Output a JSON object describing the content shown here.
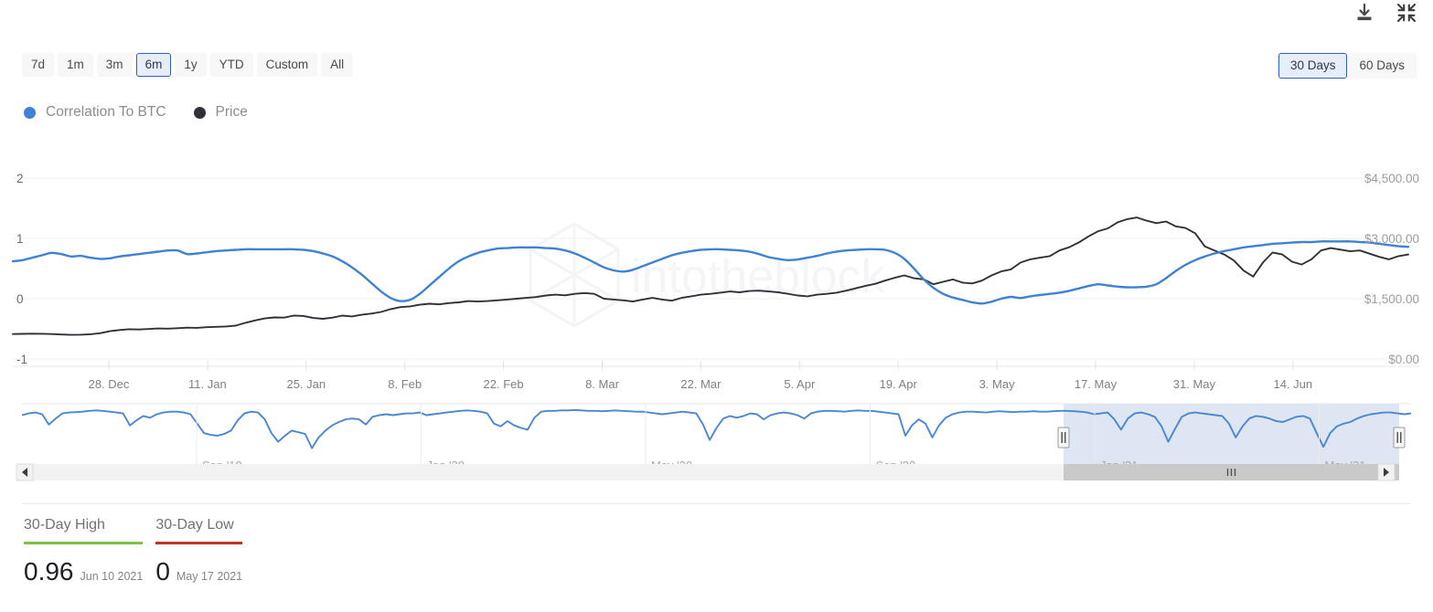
{
  "toolbar": {
    "download_icon": "download-icon",
    "collapse_icon": "collapse-icon"
  },
  "range_selector": {
    "buttons": [
      {
        "label": "7d",
        "active": false
      },
      {
        "label": "1m",
        "active": false
      },
      {
        "label": "3m",
        "active": false
      },
      {
        "label": "6m",
        "active": true
      },
      {
        "label": "1y",
        "active": false
      },
      {
        "label": "YTD",
        "active": false
      },
      {
        "label": "Custom",
        "active": false
      },
      {
        "label": "All",
        "active": false
      }
    ]
  },
  "window_selector": {
    "buttons": [
      {
        "label": "30 Days",
        "active": true
      },
      {
        "label": "60 Days",
        "active": false
      }
    ]
  },
  "legend": {
    "items": [
      {
        "label": "Correlation To BTC",
        "color": "#3e82d4",
        "icon": "circle-icon"
      },
      {
        "label": "Price",
        "color": "#2f3236",
        "icon": "circle-icon"
      }
    ]
  },
  "watermark": {
    "text": "intotheblock",
    "logo_icon": "intotheblock-logo-icon"
  },
  "navigator": {
    "tick_labels": [
      "Sep '19",
      "Jan '20",
      "May '20",
      "Sep '20",
      "Jan '21",
      "May '21"
    ],
    "selection_color": "#c3d0ea",
    "left_arrow_icon": "scroll-left-arrow-icon",
    "right_arrow_icon": "scroll-right-arrow-icon",
    "grip_icon": "scrollbar-grip-icon",
    "left_handle_icon": "range-handle-left-icon",
    "right_handle_icon": "range-handle-right-icon"
  },
  "stats": [
    {
      "title": "30-Day High",
      "value": "0.96",
      "date": "Jun 10 2021",
      "rule_color": "#7ec144"
    },
    {
      "title": "30-Day Low",
      "value": "0",
      "date": "May 17 2021",
      "rule_color": "#b8362b"
    }
  ],
  "chart_data": {
    "type": "line",
    "title": "",
    "xlabel": "",
    "ylabel": "",
    "grid": true,
    "legend_position": "top-left",
    "x_tick_labels": [
      "28. Dec",
      "11. Jan",
      "25. Jan",
      "8. Feb",
      "22. Feb",
      "8. Mar",
      "22. Mar",
      "5. Apr",
      "19. Apr",
      "3. May",
      "17. May",
      "31. May",
      "14. Jun"
    ],
    "left_axis": {
      "name": "Correlation To BTC",
      "tick_labels": [
        "2",
        "1",
        "0",
        "-1"
      ],
      "ticks": [
        2,
        1,
        0,
        -1
      ],
      "ylim": [
        -1,
        2
      ]
    },
    "right_axis": {
      "name": "Price",
      "tick_labels": [
        "$4,500.00",
        "$3,000.00",
        "$1,500.00",
        "$0.00"
      ],
      "ticks": [
        4500,
        3000,
        1500,
        0
      ],
      "ylim": [
        0,
        4500
      ]
    },
    "series": [
      {
        "name": "Correlation To BTC",
        "color": "#3e82d4",
        "axis": "left",
        "values": [
          0.62,
          0.64,
          0.68,
          0.72,
          0.76,
          0.74,
          0.7,
          0.71,
          0.68,
          0.66,
          0.67,
          0.7,
          0.72,
          0.74,
          0.76,
          0.78,
          0.8,
          0.8,
          0.74,
          0.75,
          0.77,
          0.79,
          0.8,
          0.81,
          0.82,
          0.82,
          0.82,
          0.82,
          0.82,
          0.82,
          0.81,
          0.79,
          0.75,
          0.7,
          0.62,
          0.52,
          0.4,
          0.26,
          0.12,
          0.01,
          -0.04,
          -0.02,
          0.08,
          0.22,
          0.36,
          0.5,
          0.62,
          0.7,
          0.76,
          0.8,
          0.83,
          0.84,
          0.85,
          0.85,
          0.85,
          0.84,
          0.83,
          0.8,
          0.75,
          0.68,
          0.6,
          0.52,
          0.47,
          0.45,
          0.48,
          0.54,
          0.6,
          0.66,
          0.72,
          0.76,
          0.79,
          0.81,
          0.82,
          0.82,
          0.81,
          0.8,
          0.78,
          0.74,
          0.69,
          0.66,
          0.64,
          0.65,
          0.68,
          0.71,
          0.75,
          0.78,
          0.8,
          0.81,
          0.82,
          0.82,
          0.81,
          0.76,
          0.66,
          0.5,
          0.32,
          0.18,
          0.08,
          0.02,
          -0.02,
          -0.06,
          -0.08,
          -0.05,
          0.0,
          0.03,
          0.01,
          0.04,
          0.06,
          0.08,
          0.1,
          0.13,
          0.17,
          0.21,
          0.24,
          0.22,
          0.2,
          0.19,
          0.19,
          0.2,
          0.24,
          0.34,
          0.46,
          0.56,
          0.64,
          0.7,
          0.75,
          0.79,
          0.82,
          0.85,
          0.87,
          0.89,
          0.91,
          0.92,
          0.93,
          0.94,
          0.94,
          0.95,
          0.95,
          0.95,
          0.95,
          0.94,
          0.93,
          0.91,
          0.89,
          0.87,
          0.86
        ]
      },
      {
        "name": "Price",
        "color": "#2f3236",
        "axis": "right",
        "values": [
          620,
          625,
          630,
          628,
          620,
          610,
          600,
          605,
          615,
          640,
          690,
          720,
          740,
          735,
          745,
          760,
          755,
          765,
          780,
          775,
          790,
          800,
          810,
          830,
          900,
          960,
          1010,
          1035,
          1030,
          1080,
          1070,
          1020,
          1000,
          1030,
          1080,
          1060,
          1100,
          1130,
          1170,
          1240,
          1290,
          1310,
          1350,
          1375,
          1360,
          1390,
          1410,
          1440,
          1430,
          1440,
          1460,
          1480,
          1500,
          1520,
          1540,
          1580,
          1600,
          1585,
          1620,
          1640,
          1620,
          1500,
          1480,
          1460,
          1430,
          1480,
          1520,
          1480,
          1450,
          1520,
          1560,
          1600,
          1620,
          1650,
          1680,
          1660,
          1690,
          1700,
          1680,
          1660,
          1620,
          1580,
          1560,
          1600,
          1620,
          1650,
          1700,
          1760,
          1820,
          1870,
          1950,
          2020,
          2080,
          2010,
          1980,
          1860,
          1920,
          1980,
          1900,
          1880,
          1950,
          2080,
          2180,
          2230,
          2400,
          2480,
          2520,
          2560,
          2700,
          2780,
          2900,
          3050,
          3180,
          3250,
          3400,
          3480,
          3520,
          3440,
          3380,
          3420,
          3300,
          3260,
          3130,
          2800,
          2700,
          2600,
          2450,
          2200,
          2050,
          2400,
          2650,
          2600,
          2420,
          2350,
          2480,
          2700,
          2760,
          2720,
          2680,
          2700,
          2620,
          2540,
          2480,
          2560,
          2600
        ]
      }
    ],
    "navigator_series": {
      "name": "Correlation To BTC",
      "color": "#4a87d0",
      "range_start_label": "Jan '21",
      "range_end_label": "May '21"
    }
  }
}
